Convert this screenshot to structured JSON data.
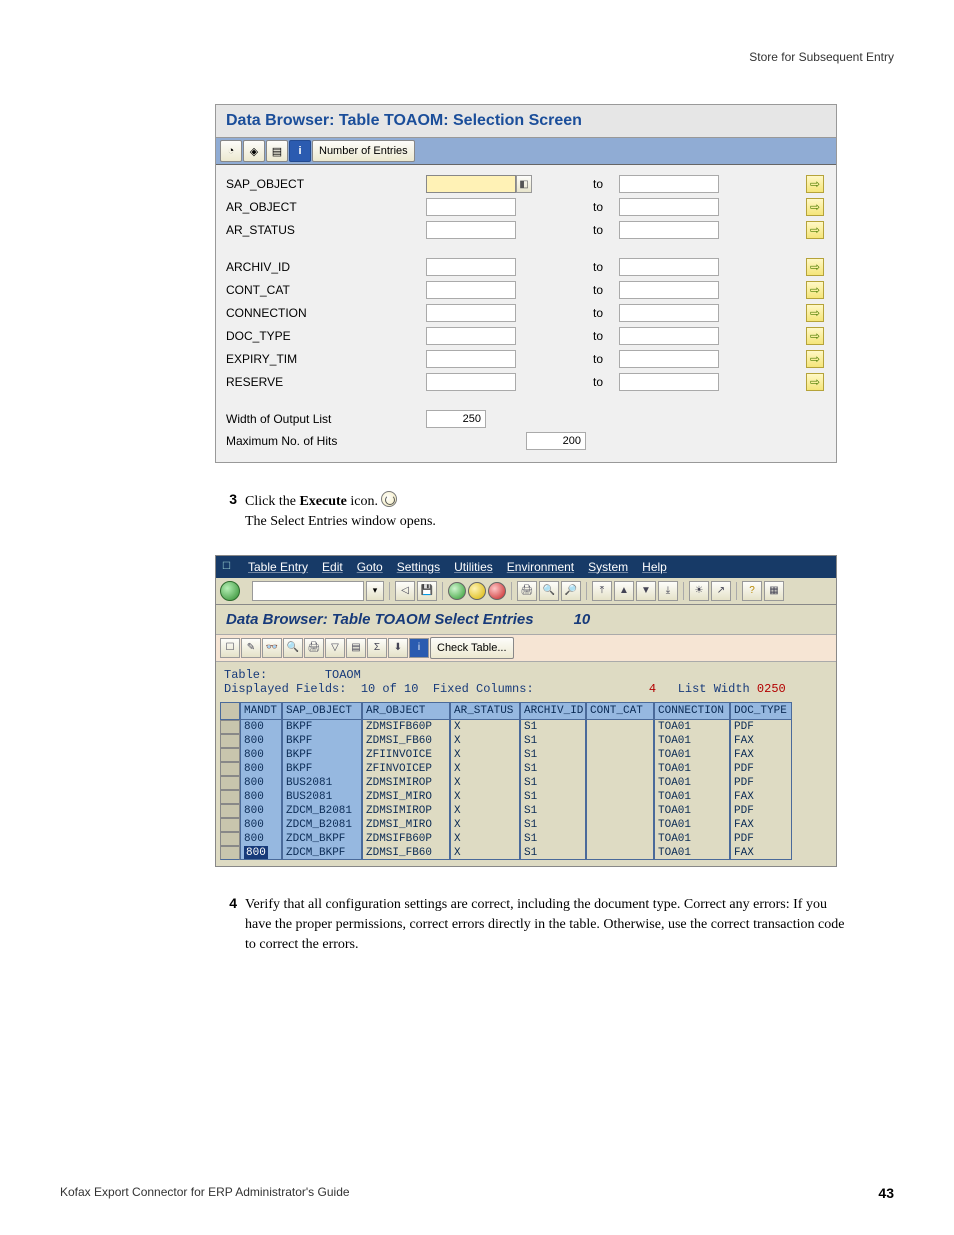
{
  "header": {
    "right": "Store for Subsequent Entry"
  },
  "fig1": {
    "title": "Data Browser: Table TOAOM: Selection Screen",
    "toolbar_num_entries": "Number of Entries",
    "fields_a": [
      {
        "label": "SAP_OBJECT",
        "to": "to",
        "focus": true,
        "help": true
      },
      {
        "label": "AR_OBJECT",
        "to": "to"
      },
      {
        "label": "AR_STATUS",
        "to": "to"
      }
    ],
    "fields_b": [
      {
        "label": "ARCHIV_ID",
        "to": "to"
      },
      {
        "label": "CONT_CAT",
        "to": "to"
      },
      {
        "label": "CONNECTION",
        "to": "to"
      },
      {
        "label": "DOC_TYPE",
        "to": "to"
      },
      {
        "label": "EXPIRY_TIM",
        "to": "to"
      },
      {
        "label": "RESERVE",
        "to": "to"
      }
    ],
    "width_label": "Width of Output List",
    "width_value": "250",
    "max_label": "Maximum No. of Hits",
    "max_value": "200"
  },
  "steps": {
    "s3num": "3",
    "s3a": "Click the ",
    "s3b": "Execute",
    "s3c": " icon.",
    "s3d": "The Select Entries window opens.",
    "s4num": "4",
    "s4": "Verify that all configuration settings are correct, including the document type. Correct any errors: If you have the proper permissions, correct errors directly in the table. Otherwise, use the correct transaction code to correct the errors."
  },
  "fig2": {
    "menus": [
      "Table Entry",
      "Edit",
      "Goto",
      "Settings",
      "Utilities",
      "Environment",
      "System",
      "Help"
    ],
    "title": "Data Browser: Table TOAOM Select Entries",
    "title_count": "10",
    "check_table": "Check Table...",
    "info_table_lbl": "Table:",
    "info_table": "TOAOM",
    "info_df_lbl": "Displayed Fields:",
    "info_df": "10 of  10",
    "info_fc_lbl": "Fixed Columns:",
    "info_fc": "4",
    "info_lw_lbl": "List Width",
    "info_lw": "0250",
    "columns": [
      "",
      "MANDT",
      "SAP_OBJECT",
      "AR_OBJECT",
      "AR_STATUS",
      "ARCHIV_ID",
      "CONT_CAT",
      "CONNECTION",
      "DOC_TYPE"
    ],
    "rows": [
      {
        "mandt": "800",
        "sap": "BKPF",
        "ar": "ZDMSIFB60P",
        "st": "X",
        "arc": "S1",
        "cc": "",
        "conn": "TOA01",
        "dt": "PDF"
      },
      {
        "mandt": "800",
        "sap": "BKPF",
        "ar": "ZDMSI_FB60",
        "st": "X",
        "arc": "S1",
        "cc": "",
        "conn": "TOA01",
        "dt": "FAX"
      },
      {
        "mandt": "800",
        "sap": "BKPF",
        "ar": "ZFIINVOICE",
        "st": "X",
        "arc": "S1",
        "cc": "",
        "conn": "TOA01",
        "dt": "FAX"
      },
      {
        "mandt": "800",
        "sap": "BKPF",
        "ar": "ZFINVOICEP",
        "st": "X",
        "arc": "S1",
        "cc": "",
        "conn": "TOA01",
        "dt": "PDF"
      },
      {
        "mandt": "800",
        "sap": "BUS2081",
        "ar": "ZDMSIMIROP",
        "st": "X",
        "arc": "S1",
        "cc": "",
        "conn": "TOA01",
        "dt": "PDF"
      },
      {
        "mandt": "800",
        "sap": "BUS2081",
        "ar": "ZDMSI_MIRO",
        "st": "X",
        "arc": "S1",
        "cc": "",
        "conn": "TOA01",
        "dt": "FAX"
      },
      {
        "mandt": "800",
        "sap": "ZDCM_B2081",
        "ar": "ZDMSIMIROP",
        "st": "X",
        "arc": "S1",
        "cc": "",
        "conn": "TOA01",
        "dt": "PDF"
      },
      {
        "mandt": "800",
        "sap": "ZDCM_B2081",
        "ar": "ZDMSI_MIRO",
        "st": "X",
        "arc": "S1",
        "cc": "",
        "conn": "TOA01",
        "dt": "FAX"
      },
      {
        "mandt": "800",
        "sap": "ZDCM_BKPF",
        "ar": "ZDMSIFB60P",
        "st": "X",
        "arc": "S1",
        "cc": "",
        "conn": "TOA01",
        "dt": "PDF"
      },
      {
        "mandt": "800",
        "sap": "ZDCM_BKPF",
        "ar": "ZDMSI_FB60",
        "st": "X",
        "arc": "S1",
        "cc": "",
        "conn": "TOA01",
        "dt": "FAX",
        "sel": true
      }
    ]
  },
  "footer": {
    "left": "Kofax Export Connector for ERP Administrator's Guide",
    "page": "43"
  }
}
